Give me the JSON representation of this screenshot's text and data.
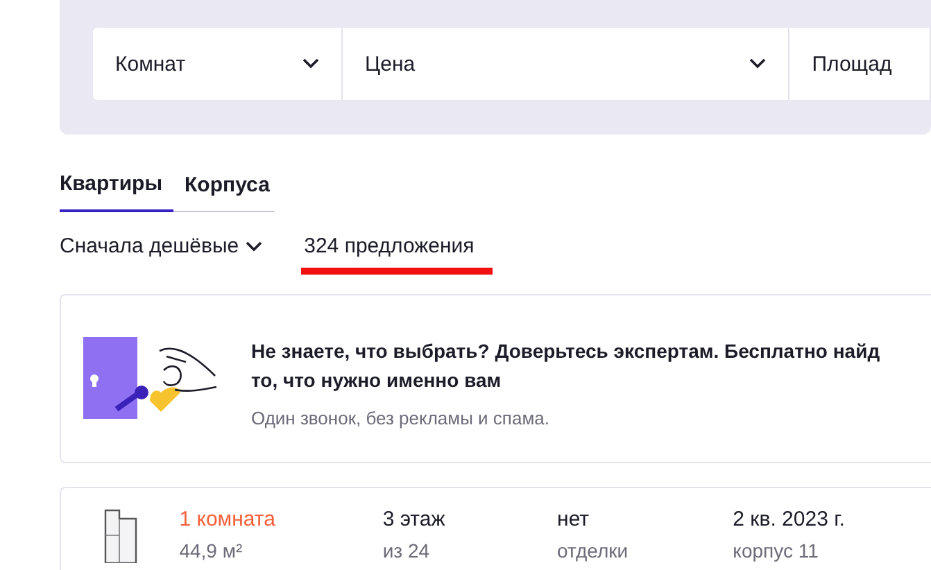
{
  "filters": [
    {
      "label": "Комнат",
      "kind": "dropdown"
    },
    {
      "label": "Цена",
      "kind": "dropdown"
    },
    {
      "label": "Площад",
      "kind": "text"
    }
  ],
  "tabs": [
    {
      "label": "Квартиры",
      "selected": true
    },
    {
      "label": "Корпуса",
      "selected": false
    }
  ],
  "sort": {
    "label": "Сначала дешёвые"
  },
  "count": {
    "label": "324 предложения",
    "underlined": true
  },
  "promo": {
    "headline_lines": [
      "Не знаете, что выбрать? Доверьтесь экспертам. Бесплатно найд",
      "то, что нужно именно вам"
    ],
    "subtitle": "Один звонок, без рекламы и спама."
  },
  "listing": {
    "rooms": "1 комната",
    "area": "44,9 м²",
    "floor": "3 этаж",
    "floor_total": "из 24",
    "finish": "нет",
    "finish_note": "отделки",
    "deadline": "2 кв. 2023 г.",
    "building": "корпус 11"
  }
}
